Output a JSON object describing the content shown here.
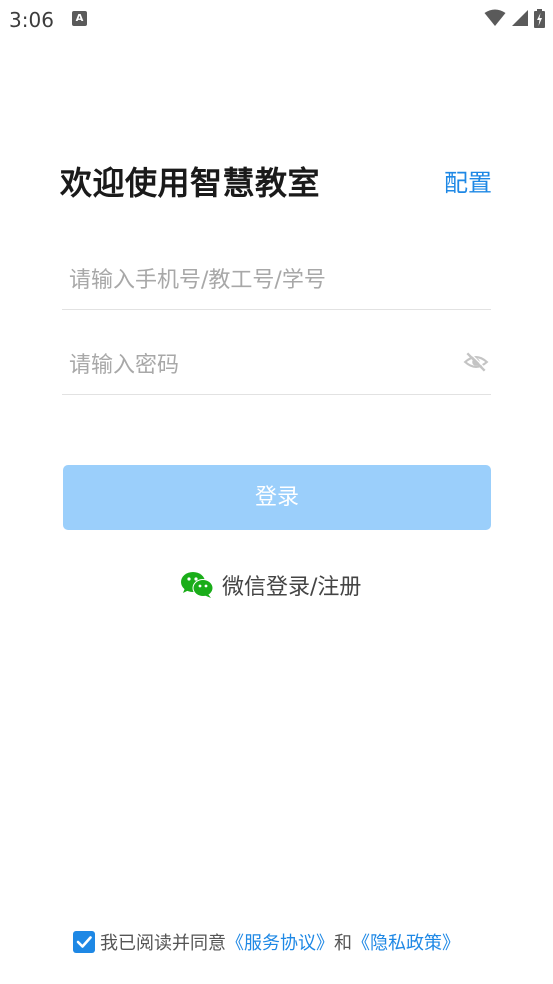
{
  "status_bar": {
    "time": "3:06",
    "notification_icon": "A",
    "icons": [
      "wifi-icon",
      "signal-icon",
      "battery-charging-icon"
    ]
  },
  "header": {
    "title": "欢迎使用智慧教室",
    "config_label": "配置"
  },
  "form": {
    "account_placeholder": "请输入手机号/教工号/学号",
    "account_value": "",
    "password_placeholder": "请输入密码",
    "password_value": "",
    "password_toggle_icon": "eye-off-icon",
    "login_label": "登录"
  },
  "wechat": {
    "label": "微信登录/注册",
    "icon": "wechat-icon"
  },
  "agreement": {
    "checked": true,
    "prefix": "我已阅读并同意",
    "service_link": "《服务协议》",
    "conjunction": "和",
    "privacy_link": "《隐私政策》"
  },
  "colors": {
    "accent": "#1e88e5",
    "login_button_disabled": "#9bcffb",
    "wechat_green": "#1aad19"
  }
}
